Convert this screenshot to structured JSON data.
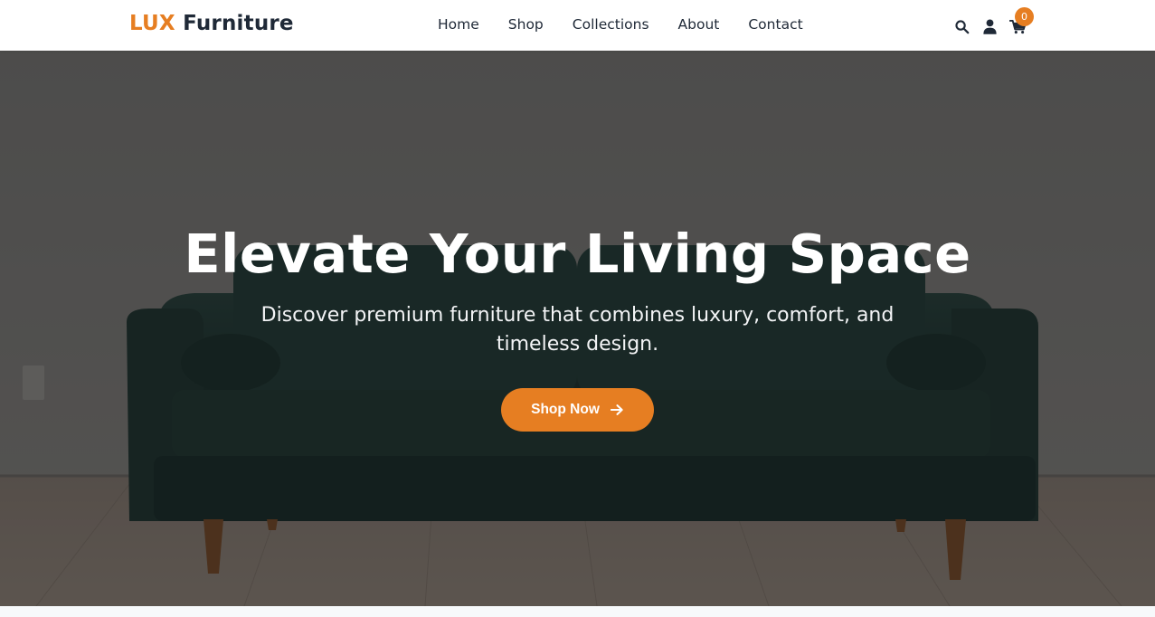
{
  "header": {
    "logo_accent": "LUX",
    "logo_rest": "Furniture",
    "nav": [
      "Home",
      "Shop",
      "Collections",
      "About",
      "Contact"
    ],
    "icons": {
      "search": "search-icon",
      "user": "user-icon",
      "cart": "cart-icon"
    },
    "cart_count": "0"
  },
  "hero": {
    "title": "Elevate Your Living Space",
    "subtitle": "Discover premium furniture that combines luxury, comfort, and timeless design.",
    "cta_label": "Shop Now",
    "cta_icon": "arrow-right-icon"
  },
  "colors": {
    "accent": "#e67e22",
    "text_dark": "#1f2937",
    "hero_overlay": "rgba(0,0,0,0.45)"
  }
}
